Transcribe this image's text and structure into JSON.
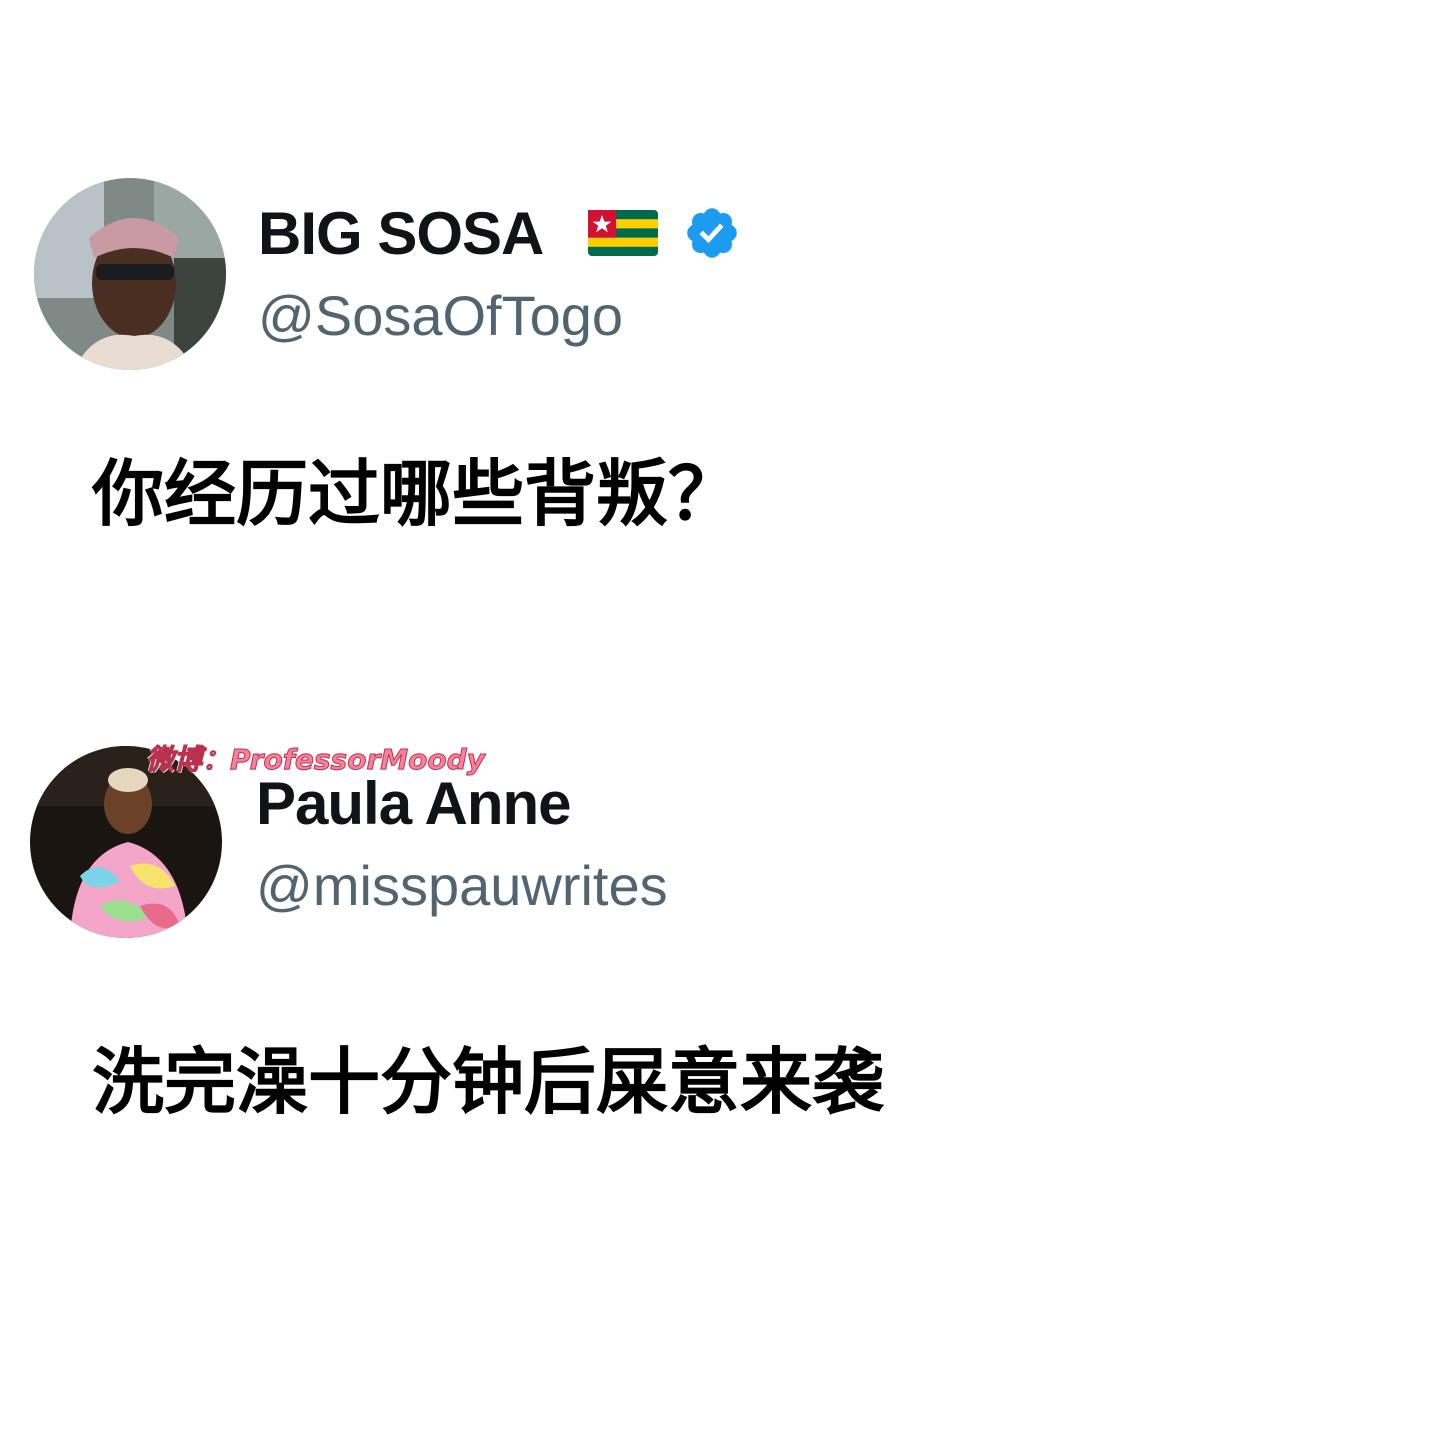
{
  "tweets": [
    {
      "display_name": "BIG SOSA",
      "flag_icon": "togo-flag-icon",
      "verified": true,
      "verified_color": "#1d9bf0",
      "handle": "@SosaOfTogo",
      "text": "你经历过哪些背叛？"
    },
    {
      "display_name": "Paula Anne",
      "verified": false,
      "handle": "@misspauwrites",
      "text": "洗完澡十分钟后屎意来袭"
    }
  ],
  "watermark": {
    "text": "微博：ProfessorMoody",
    "color": "#ff7f9a"
  }
}
